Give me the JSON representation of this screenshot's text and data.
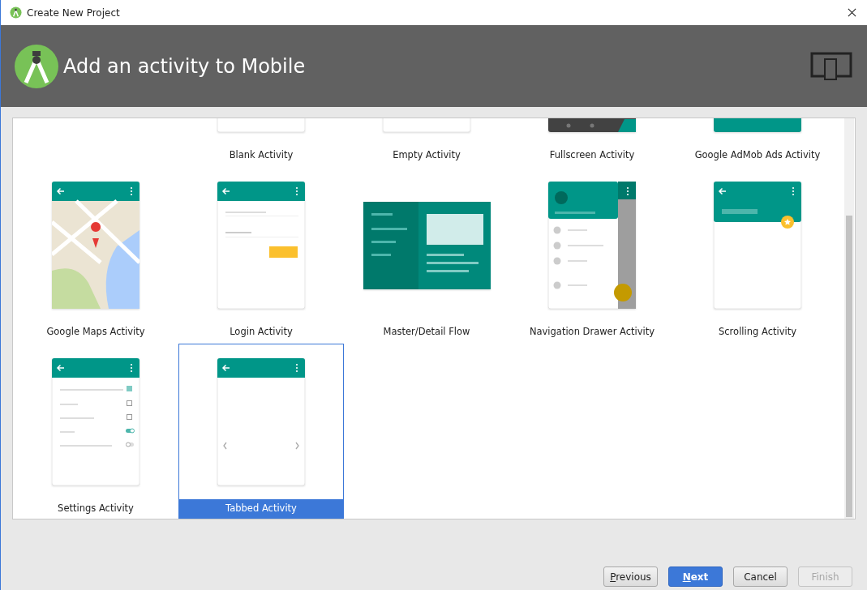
{
  "window": {
    "title": "Create New Project"
  },
  "header": {
    "title": "Add an activity to Mobile"
  },
  "activities": [
    {
      "label": "Blank Activity",
      "kind": "blank",
      "selected": false
    },
    {
      "label": "Empty Activity",
      "kind": "empty",
      "selected": false
    },
    {
      "label": "Fullscreen Activity",
      "kind": "fullscreen",
      "selected": false
    },
    {
      "label": "Google AdMob Ads Activity",
      "kind": "admob",
      "selected": false
    },
    {
      "label": "Google Maps Activity",
      "kind": "maps",
      "selected": false
    },
    {
      "label": "Login Activity",
      "kind": "login",
      "selected": false
    },
    {
      "label": "Master/Detail Flow",
      "kind": "master_detail",
      "selected": false
    },
    {
      "label": "Navigation Drawer Activity",
      "kind": "nav_drawer",
      "selected": false
    },
    {
      "label": "Scrolling Activity",
      "kind": "scrolling",
      "selected": false
    },
    {
      "label": "Settings Activity",
      "kind": "settings",
      "selected": false
    },
    {
      "label": "Tabbed Activity",
      "kind": "tabbed",
      "selected": true
    }
  ],
  "buttons": [
    {
      "label": "Previous",
      "kind": "normal",
      "underline_first": true,
      "disabled": false
    },
    {
      "label": "Next",
      "kind": "primary",
      "underline_first": true,
      "disabled": false
    },
    {
      "label": "Cancel",
      "kind": "normal",
      "underline_first": false,
      "disabled": false
    },
    {
      "label": "Finish",
      "kind": "normal",
      "underline_first": false,
      "disabled": true
    }
  ]
}
